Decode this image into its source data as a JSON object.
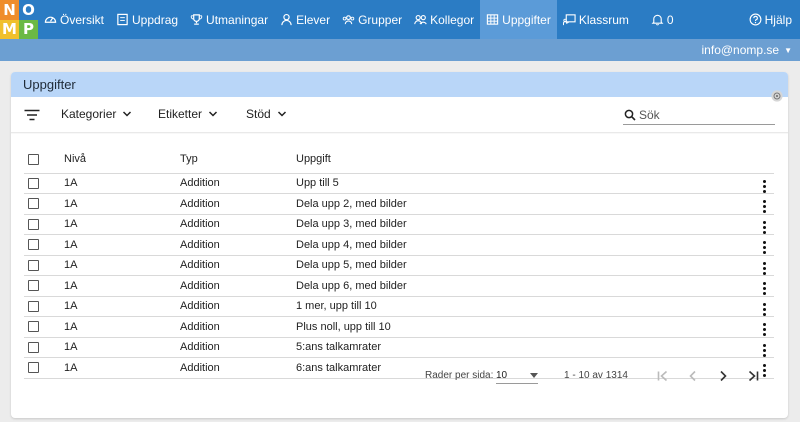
{
  "logo": [
    "N",
    "O",
    "M",
    "P"
  ],
  "nav": [
    {
      "label": "Översikt",
      "icon": "dashboard-icon"
    },
    {
      "label": "Uppdrag",
      "icon": "book-icon"
    },
    {
      "label": "Utmaningar",
      "icon": "trophy-icon"
    },
    {
      "label": "Elever",
      "icon": "person-icon"
    },
    {
      "label": "Grupper",
      "icon": "group-icon"
    },
    {
      "label": "Kollegor",
      "icon": "colleagues-icon"
    },
    {
      "label": "Uppgifter",
      "icon": "grid-icon",
      "active": true
    },
    {
      "label": "Klassrum",
      "icon": "classroom-icon"
    },
    {
      "label": "0",
      "icon": "bell-icon"
    }
  ],
  "help_label": "Hjälp",
  "user_email": "info@nomp.se",
  "card_title": "Uppgifter",
  "filters": {
    "kategorier": "Kategorier",
    "etiketter": "Etiketter",
    "stod": "Stöd"
  },
  "search": {
    "placeholder": "Sök",
    "value": ""
  },
  "table": {
    "headers": {
      "niva": "Nivå",
      "typ": "Typ",
      "uppgift": "Uppgift"
    },
    "rows": [
      {
        "niva": "1A",
        "typ": "Addition",
        "uppgift": "Upp till 5"
      },
      {
        "niva": "1A",
        "typ": "Addition",
        "uppgift": "Dela upp 2, med bilder"
      },
      {
        "niva": "1A",
        "typ": "Addition",
        "uppgift": "Dela upp 3, med bilder"
      },
      {
        "niva": "1A",
        "typ": "Addition",
        "uppgift": "Dela upp 4, med bilder"
      },
      {
        "niva": "1A",
        "typ": "Addition",
        "uppgift": "Dela upp 5, med bilder"
      },
      {
        "niva": "1A",
        "typ": "Addition",
        "uppgift": "Dela upp 6, med bilder"
      },
      {
        "niva": "1A",
        "typ": "Addition",
        "uppgift": "1 mer, upp till 10"
      },
      {
        "niva": "1A",
        "typ": "Addition",
        "uppgift": "Plus noll, upp till 10"
      },
      {
        "niva": "1A",
        "typ": "Addition",
        "uppgift": "5:ans talkamrater"
      },
      {
        "niva": "1A",
        "typ": "Addition",
        "uppgift": "6:ans talkamrater"
      }
    ]
  },
  "pagination": {
    "rows_per_page_label": "Rader per sida:",
    "rows_per_page": "10",
    "range": "1 - 10 av 1314"
  },
  "colors": {
    "topbar": "#2b7cc4",
    "active_tab": "#5b9bd8",
    "subbar": "#6c9fd2",
    "card_header": "#b9d6f8"
  }
}
